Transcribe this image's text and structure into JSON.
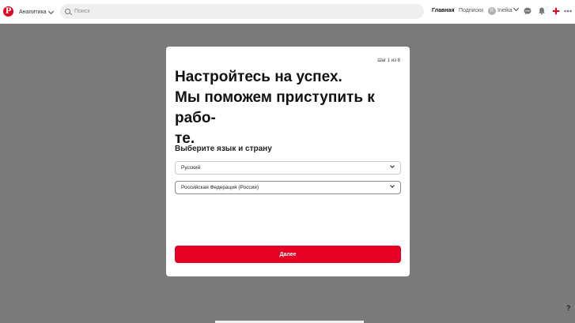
{
  "header": {
    "analytics_label": "Аналитика",
    "search_placeholder": "Поиск",
    "home_label": "Главная",
    "following_label": "Подписки",
    "avatar_initial": "R",
    "username": "Ineika"
  },
  "modal": {
    "step": "Шаг 1 из 8",
    "headline_lines": [
      "Настройтесь на успех.",
      "Мы поможем приступить к рабо-",
      "те."
    ],
    "subtitle": "Выберите язык и страну",
    "language_value": "Русский",
    "country_value": "Российская Федерация (Россия)",
    "next_label": "Далее"
  },
  "help_label": "?",
  "colors": {
    "accent": "#e60023",
    "backdrop": "#7b7b7b"
  },
  "icons": [
    "pinterest-logo",
    "search-icon",
    "messages-icon",
    "notifications-icon",
    "add-icon",
    "more-icon",
    "chevron-down-icon"
  ]
}
